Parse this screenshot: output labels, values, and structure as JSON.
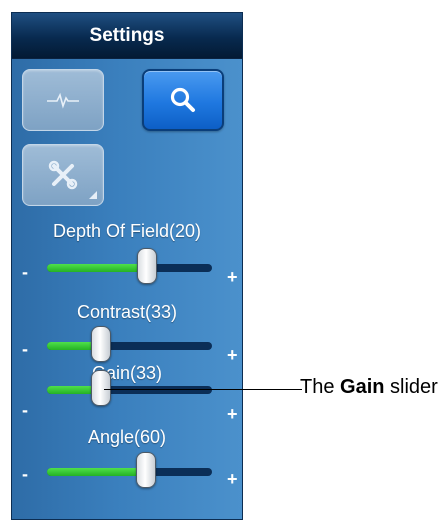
{
  "panel": {
    "title": "Settings"
  },
  "toolbar": {
    "buttons": [
      {
        "icon": "waveform-icon",
        "state": "disabled"
      },
      {
        "icon": "search-icon",
        "state": "active"
      },
      {
        "icon": "tools-icon",
        "state": "disabled",
        "has_dropdown": true
      }
    ]
  },
  "sliders": [
    {
      "label": "Depth Of Field(20)",
      "value": 20,
      "max": 33,
      "minus": "-",
      "plus": "+"
    },
    {
      "label": "Contrast(33)",
      "value": 33,
      "max": 100,
      "minus": "-",
      "plus": "+"
    },
    {
      "label": "Gain(33)",
      "value": 33,
      "max": 100,
      "minus": "-",
      "plus": "+"
    },
    {
      "label": "Angle(60)",
      "value": 60,
      "max": 100,
      "minus": "-",
      "plus": "+"
    }
  ],
  "annotation": {
    "prefix": "The ",
    "bold": "Gain",
    "suffix": " slider"
  },
  "colors": {
    "track_fill": "#25b225",
    "track_empty": "#0b2e57",
    "active_button": "#1f78e0"
  }
}
